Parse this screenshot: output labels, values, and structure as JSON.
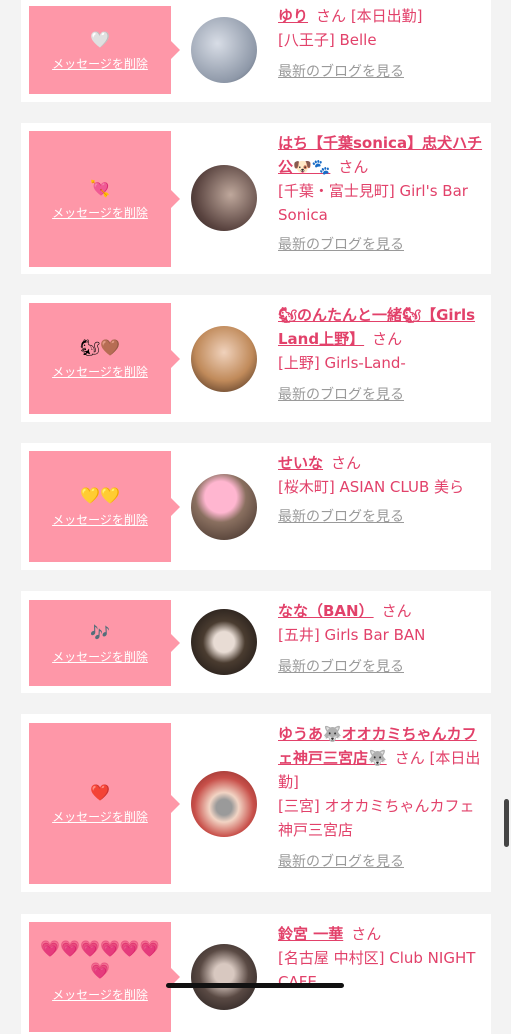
{
  "cards": [
    {
      "emoji": "🤍",
      "delete_label": "メッセージを削除",
      "name": "ゆり",
      "suffix": "さん",
      "badge": "[本日出勤]",
      "shop": "[八王子] Belle",
      "blog": "最新のブログを見る",
      "avatar_icon": "profile-photo"
    },
    {
      "emoji": "💘",
      "delete_label": "メッセージを削除",
      "name": "はち【千葉sonica】忠犬ハチ公🐶🐾",
      "suffix": "さん",
      "badge": "",
      "shop": "[千葉・富士見町] Girl's Bar Sonica",
      "blog": "最新のブログを見る",
      "avatar_icon": "profile-photo"
    },
    {
      "emoji": "🐿🤎",
      "delete_label": "メッセージを削除",
      "name": "🐿のんたんと一緒🐿【Girls Land上野】",
      "suffix": "さん",
      "badge": "",
      "shop": "[上野] Girls-Land-",
      "blog": "最新のブログを見る",
      "avatar_icon": "profile-photo"
    },
    {
      "emoji": "💛💛",
      "delete_label": "メッセージを削除",
      "name": "せいな",
      "suffix": "さん",
      "badge": "",
      "shop": "[桜木町] ASIAN CLUB 美ら",
      "blog": "最新のブログを見る",
      "avatar_icon": "profile-photo"
    },
    {
      "emoji": "🎶",
      "delete_label": "メッセージを削除",
      "name": "なな（BAN）",
      "suffix": "さん",
      "badge": "",
      "shop": "[五井] Girls Bar BAN",
      "blog": "最新のブログを見る",
      "avatar_icon": "profile-photo"
    },
    {
      "emoji": "❤️",
      "delete_label": "メッセージを削除",
      "name": "ゆうあ🐺オオカミちゃんカフェ神戸三宮店🐺",
      "suffix": "さん",
      "badge": "[本日出勤]",
      "shop": "[三宮] オオカミちゃんカフェ神戸三宮店",
      "blog": "最新のブログを見る",
      "avatar_icon": "profile-photo"
    },
    {
      "emoji": "💗💗💗💗💗💗💗",
      "delete_label": "メッセージを削除",
      "name": "鈴宮 一華",
      "suffix": "さん",
      "badge": "",
      "shop": "[名古屋 中村区] Club NIGHT CAFE",
      "blog": "",
      "avatar_icon": "profile-photo"
    }
  ],
  "colors": {
    "accent": "#e2416a",
    "message_box": "#fe97a8",
    "background": "#f3f3f3"
  }
}
